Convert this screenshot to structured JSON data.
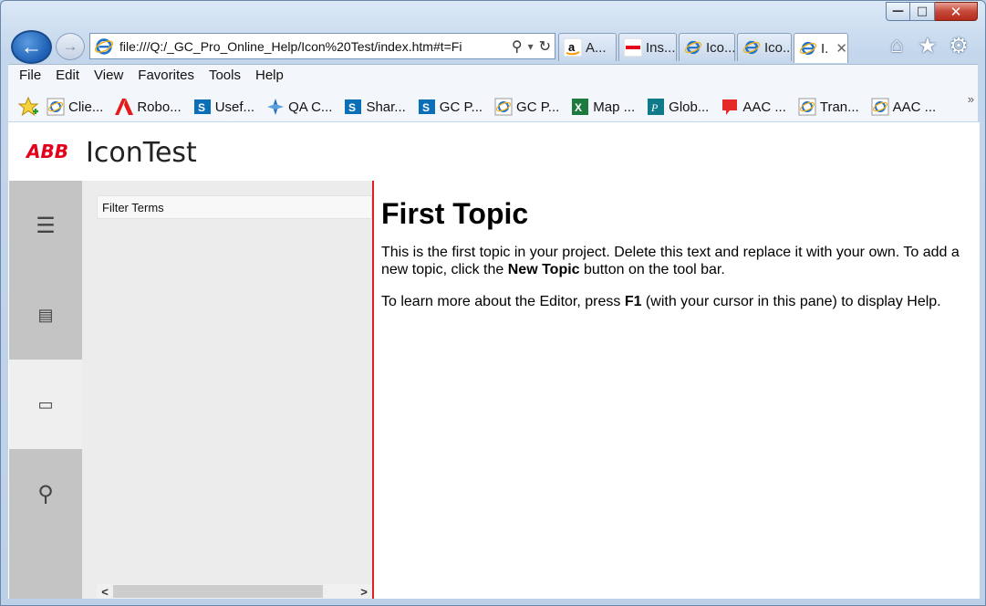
{
  "window": {
    "minimize_icon": "minimize-icon",
    "maximize_icon": "maximize-icon",
    "close_icon": "close-icon",
    "minimize_glyph": "—",
    "maximize_glyph": "□",
    "close_glyph": "✕"
  },
  "nav": {
    "address": "file:///Q:/_GC_Pro_Online_Help/Icon%20Test/index.htm#t=Fi",
    "back_glyph": "←",
    "forward_glyph": "→",
    "search_glyph": "⚲",
    "dropdown_glyph": "▾",
    "refresh_glyph": "↻"
  },
  "tabs": [
    {
      "label": "A...",
      "icon": "amazon-icon",
      "active": false
    },
    {
      "label": "Ins...",
      "icon": "abb-icon",
      "active": false
    },
    {
      "label": "Ico...",
      "icon": "ie-icon",
      "active": false
    },
    {
      "label": "Ico...",
      "icon": "ie-icon",
      "active": false
    },
    {
      "label": "I.",
      "icon": "ie-icon",
      "active": true,
      "close": "✕"
    }
  ],
  "toolbar_icons": {
    "home": "⌂",
    "favorites": "★",
    "settings": "⚙"
  },
  "menubar": [
    "File",
    "Edit",
    "View",
    "Favorites",
    "Tools",
    "Help"
  ],
  "favorites": [
    {
      "label": "Clie...",
      "icon": "ie-icon"
    },
    {
      "label": "Robo...",
      "icon": "adobe-icon"
    },
    {
      "label": "Usef...",
      "icon": "sharepoint-icon"
    },
    {
      "label": "QA C...",
      "icon": "compass-icon"
    },
    {
      "label": "Shar...",
      "icon": "sharepoint-icon"
    },
    {
      "label": "GC P...",
      "icon": "sharepoint-icon"
    },
    {
      "label": "GC P...",
      "icon": "ie-icon"
    },
    {
      "label": "Map ...",
      "icon": "excel-icon"
    },
    {
      "label": "Glob...",
      "icon": "publisher-icon"
    },
    {
      "label": "AAC ...",
      "icon": "comment-icon"
    },
    {
      "label": "Tran...",
      "icon": "ie-icon"
    },
    {
      "label": "AAC ...",
      "icon": "ie-icon"
    }
  ],
  "favorites_overflow": "»",
  "page": {
    "brand": "ABB",
    "title": "IconTest",
    "filter_placeholder": "Filter Terms",
    "rail": [
      {
        "name": "toc",
        "icon": "list-icon",
        "glyph": "☰",
        "selected": false
      },
      {
        "name": "index",
        "icon": "index-icon",
        "glyph": "▤",
        "selected": false
      },
      {
        "name": "glossary",
        "icon": "glossary-icon",
        "glyph": "▭",
        "selected": true
      },
      {
        "name": "search",
        "icon": "search-icon",
        "glyph": "⚲",
        "selected": false
      }
    ],
    "scroll_left": "<",
    "scroll_right": ">",
    "topic": {
      "heading": "First Topic",
      "p1_a": "This is the first topic in your project. Delete this text and replace it with your own. To add a new topic, click the ",
      "p1_bold": "New Topic",
      "p1_b": " button on the tool bar.",
      "p2_a": "To learn more about the Editor, press ",
      "p2_bold": "F1",
      "p2_b": " (with your cursor in this pane) to display Help."
    }
  }
}
